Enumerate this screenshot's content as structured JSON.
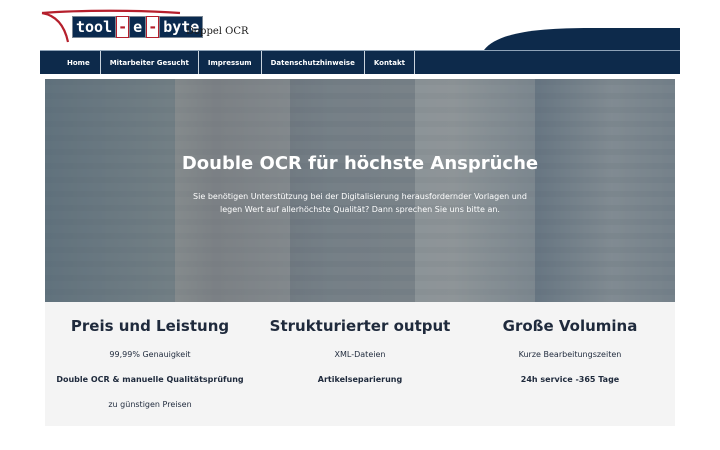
{
  "header": {
    "logo_parts": [
      "tool",
      "-",
      "e",
      "-",
      "byte"
    ],
    "site_title": "Doppel OCR"
  },
  "nav": {
    "items": [
      "Home",
      "Mitarbeiter Gesucht",
      "Impressum",
      "Datenschutzhinweise",
      "Kontakt"
    ]
  },
  "hero": {
    "title": "Double OCR für höchste Ansprüche",
    "text": "Sie benötigen Unterstützung bei der Digitalisierung herausfordernder Vorlagen und legen Wert auf allerhöchste Qualität? Dann sprechen Sie uns bitte an."
  },
  "features": [
    {
      "title": "Preis und Leistung",
      "line1": "99,99% Genauigkeit",
      "line2": "Double OCR & manuelle Qualitätsprüfung",
      "line3": "zu günstigen Preisen"
    },
    {
      "title": "Strukturierter output",
      "line1": "XML-Dateien",
      "line2": "Artikelseparierung",
      "line3": ""
    },
    {
      "title": "Große Volumina",
      "line1": "Kurze Bearbeitungszeiten",
      "line2": "24h service -365 Tage",
      "line3": ""
    }
  ],
  "colors": {
    "brand_navy": "#0d2a4b",
    "brand_red": "#b51f2c",
    "feature_bg": "#f4f4f4"
  }
}
